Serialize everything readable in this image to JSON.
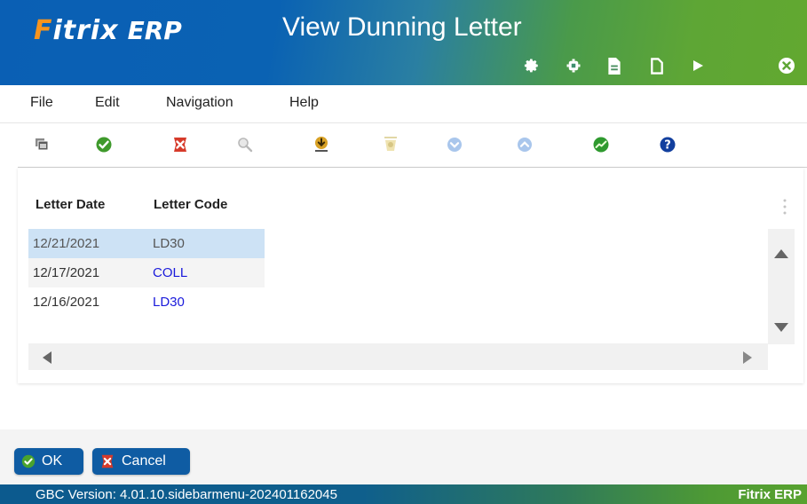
{
  "header": {
    "logo_brand": "Fitrix",
    "logo_erp": "ERP",
    "title": "View Dunning Letter",
    "icons": [
      "gear-icon",
      "chip-icon",
      "document-icon",
      "page-icon",
      "play-icon",
      "close-circle-icon"
    ]
  },
  "menu": {
    "items": [
      "File",
      "Edit",
      "Navigation",
      "Help"
    ]
  },
  "toolbar": {
    "buttons": [
      "windows-icon",
      "accept-icon",
      "cancel-icon",
      "zoom-icon",
      "download-icon",
      "attach-icon",
      "down-icon",
      "up-icon",
      "chart-icon",
      "help-icon"
    ]
  },
  "table": {
    "columns": [
      "Letter Date",
      "Letter Code"
    ],
    "rows": [
      {
        "date": "12/21/2021",
        "code": "LD30"
      },
      {
        "date": "12/17/2021",
        "code": "COLL"
      },
      {
        "date": "12/16/2021",
        "code": "LD30"
      }
    ],
    "selected_row": 0
  },
  "actions": {
    "ok_label": "OK",
    "cancel_label": "Cancel"
  },
  "status": {
    "version": "GBC Version: 4.01.10.sidebarmenu-202401162045",
    "app": "Fitrix ERP"
  },
  "colors": {
    "header_blue": "#0a5fb4",
    "header_green": "#62a830",
    "button_blue": "#0f5ca3",
    "selection": "#cde2f5",
    "link_blue": "#1a1adb"
  }
}
